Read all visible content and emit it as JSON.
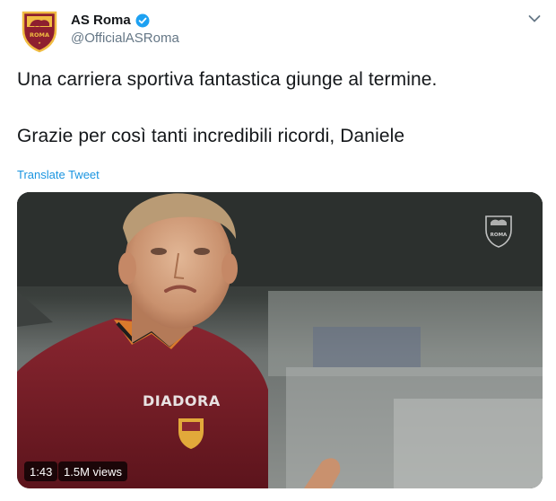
{
  "author": {
    "name": "AS Roma",
    "handle": "@OfficialASRoma",
    "verified": true,
    "avatar_text": "ROMA"
  },
  "tweet": {
    "line1": "Una carriera sportiva fantastica giunge al termine.",
    "line2": "Grazie per così tanti incredibili ricordi, Daniele",
    "translate_label": "Translate Tweet"
  },
  "video": {
    "duration": "1:43",
    "views": "1.5M views",
    "shirt_brand": "DIADORA",
    "watermark_text": "ROMA"
  },
  "icons": {
    "verified": "verified-badge-icon",
    "caret": "chevron-down-icon"
  },
  "colors": {
    "link": "#1b95e0",
    "verified": "#1da1f2",
    "roma_red": "#8e1f2f",
    "roma_gold": "#f0bc42"
  }
}
